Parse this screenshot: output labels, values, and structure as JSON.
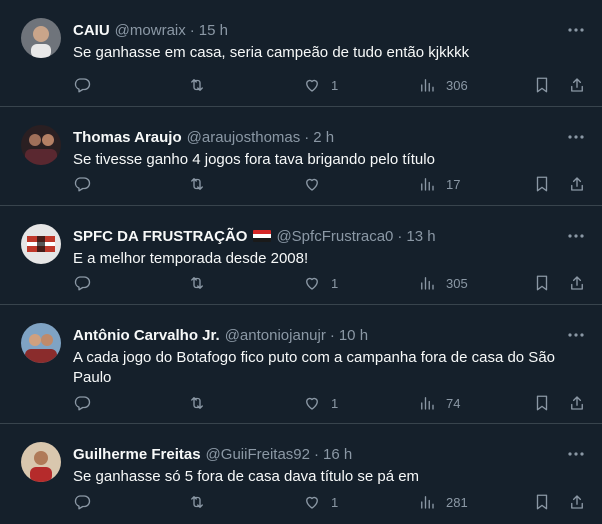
{
  "tweets": [
    {
      "name": "CAIU",
      "handle": "@mowraix",
      "separator": "·",
      "time": "15 h",
      "text": "Se ganhasse em casa, seria campeão de tudo então kjkkkk",
      "likes": "1",
      "views": "306",
      "avatar_color": "#8a8f96"
    },
    {
      "name": "Thomas Araujo",
      "handle": "@araujosthomas",
      "separator": "·",
      "time": "2 h",
      "text": "Se tivesse ganho 4 jogos fora tava brigando pelo título",
      "likes": "",
      "views": "17",
      "avatar_color": "#3a2a2a"
    },
    {
      "name": "SPFC DA FRUSTRAÇÃO",
      "handle": "@SpfcFrustraca0",
      "separator": "·",
      "time": "13 h",
      "text": "E a melhor temporada desde 2008!",
      "likes": "1",
      "views": "305",
      "avatar_color": "#d8d8d8"
    },
    {
      "name": "Antônio Carvalho Jr.",
      "handle": "@antoniojanujr",
      "separator": "·",
      "time": "10 h",
      "text": "A cada jogo do Botafogo fico puto com a campanha fora de casa do São Paulo",
      "likes": "1",
      "views": "74",
      "avatar_color": "#6a8fb0"
    },
    {
      "name": "Guilherme Freitas",
      "handle": "@GuiiFreitas92",
      "separator": "·",
      "time": "16 h",
      "text": "Se ganhasse só 5 fora de casa dava título se pá em",
      "likes": "1",
      "views": "281",
      "avatar_color": "#c9b8a0"
    }
  ],
  "colors": {
    "background": "#15202b",
    "divider": "#38444d",
    "secondary_text": "#8b98a5",
    "primary_text": "#f7f9f9"
  },
  "icons": {
    "more": "more-icon",
    "reply": "reply-icon",
    "retweet": "retweet-icon",
    "like": "like-icon",
    "views": "views-icon",
    "bookmark": "bookmark-icon",
    "share": "share-icon",
    "flag": "flag-icon"
  }
}
